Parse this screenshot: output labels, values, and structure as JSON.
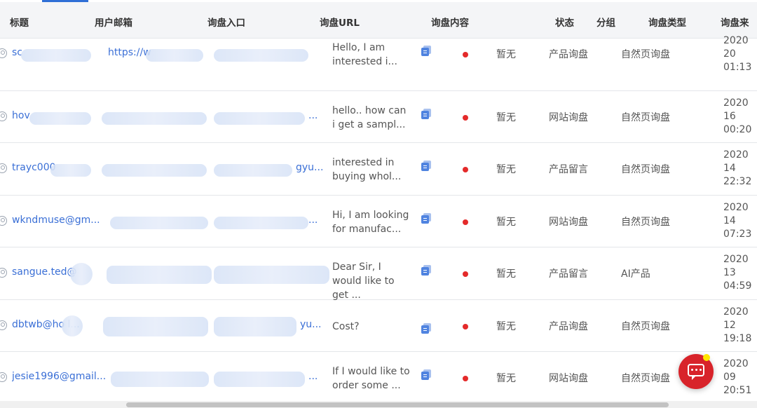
{
  "table": {
    "headers": [
      "标题",
      "用户邮箱",
      "询盘入口",
      "询盘URL",
      "询盘内容",
      "状态",
      "分组",
      "询盘类型",
      "询盘来"
    ],
    "rows": [
      {
        "email": "sc",
        "url": "https://w",
        "content": "Hello, I am interested i...",
        "status": "暂无",
        "group": "产品询盘",
        "type": "自然页询盘",
        "time": "2020\n20\n01:13"
      },
      {
        "email": "hov",
        "url": "...",
        "content": "hello.. how can i get a sampl...",
        "status": "暂无",
        "group": "网站询盘",
        "type": "自然页询盘",
        "time": "2020\n16\n00:20"
      },
      {
        "email": "trayc000",
        "url": "gyu...",
        "content": "interested in buying whol...",
        "status": "暂无",
        "group": "产品留言",
        "type": "自然页询盘",
        "time": "2020\n14\n22:32"
      },
      {
        "email": "wkndmuse@gm...",
        "url": "...",
        "content": "Hi, I am looking for manufac...",
        "status": "暂无",
        "group": "网站询盘",
        "type": "自然页询盘",
        "time": "2020\n14\n07:23"
      },
      {
        "email": "sangue.ted@",
        "url": "",
        "content": "Dear Sir, I would like to get ...",
        "status": "暂无",
        "group": "产品留言",
        "type": "AI产品",
        "time": "2020\n13\n04:59"
      },
      {
        "email": "dbtwb@ho l...",
        "url": "yu...",
        "content": "Cost?",
        "status": "暂无",
        "group": "产品询盘",
        "type": "自然页询盘",
        "time": "2020\n12\n19:18"
      },
      {
        "email": "jesie1996@gmail...",
        "url": "...",
        "content": "If I would like to order some ...",
        "status": "暂无",
        "group": "网站询盘",
        "type": "自然页询盘",
        "time": "2020\n09\n20:51"
      }
    ]
  },
  "colors": {
    "accent": "#3a6fd6",
    "status_dot": "#e42a2a",
    "chat_button": "#d8232a"
  },
  "icons": {
    "user": "user-icon",
    "copy": "copy-icon",
    "chat": "chat-icon"
  }
}
